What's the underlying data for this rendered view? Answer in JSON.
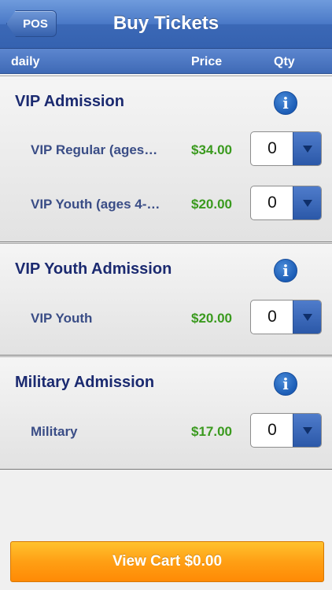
{
  "header": {
    "back_label": "POS",
    "title": "Buy Tickets"
  },
  "columns": {
    "name": "daily",
    "price": "Price",
    "qty": "Qty"
  },
  "sections": [
    {
      "title": "VIP Admission",
      "info_icon": "info-icon",
      "items": [
        {
          "name": "VIP Regular (ages…",
          "price": "$34.00",
          "qty": "0"
        },
        {
          "name": "VIP Youth (ages 4-…",
          "price": "$20.00",
          "qty": "0"
        }
      ]
    },
    {
      "title": "VIP Youth Admission",
      "info_icon": "info-icon",
      "items": [
        {
          "name": "VIP Youth",
          "price": "$20.00",
          "qty": "0"
        }
      ]
    },
    {
      "title": "Military Admission",
      "info_icon": "info-icon",
      "items": [
        {
          "name": "Military",
          "price": "$17.00",
          "qty": "0"
        }
      ]
    }
  ],
  "footer": {
    "cart_label": "View Cart $0.00"
  },
  "colors": {
    "nav_blue": "#3b68b6",
    "title_navy": "#1b2a70",
    "price_green": "#3a9a1e",
    "cart_orange": "#ff9f14"
  }
}
